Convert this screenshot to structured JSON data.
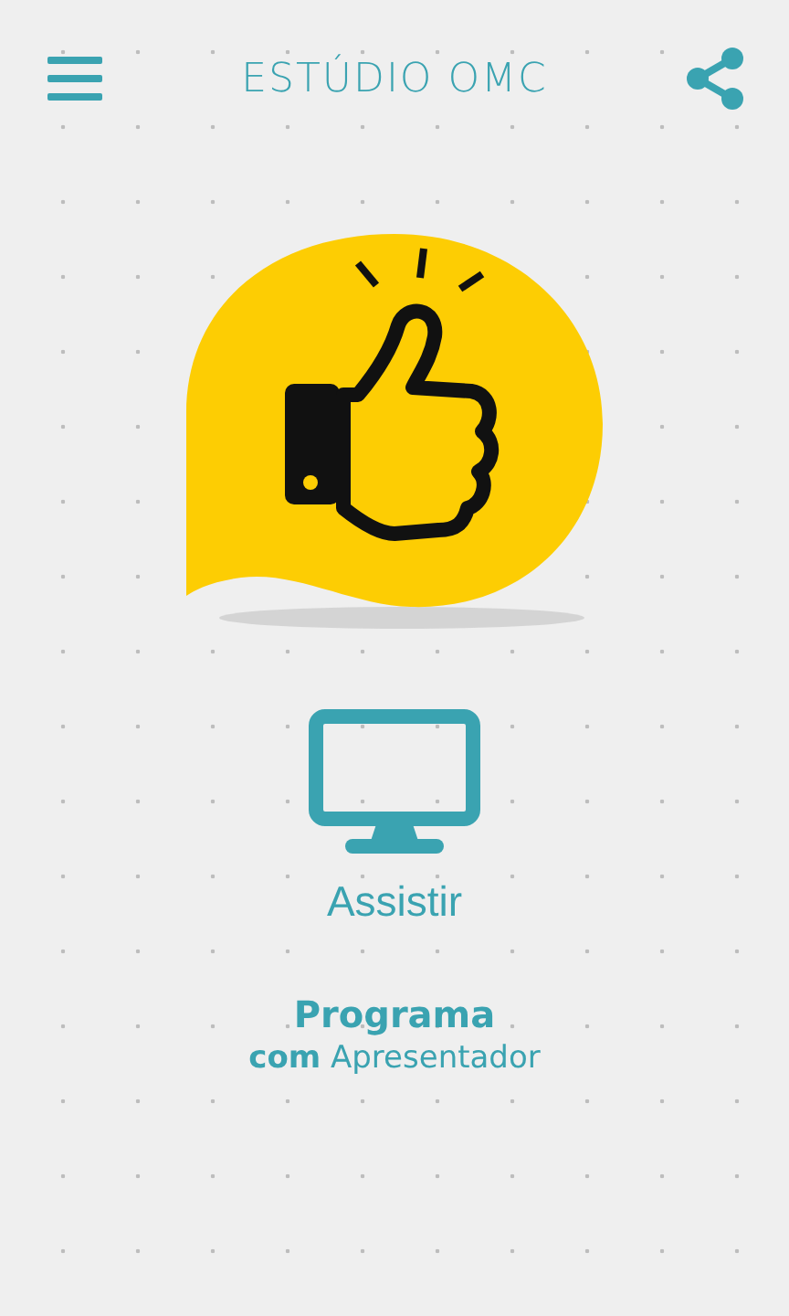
{
  "header": {
    "title": "ESTÚDIO OMC"
  },
  "action": {
    "label": "Assistir"
  },
  "program": {
    "title": "Programa",
    "subtitle": "**com** Apresentador"
  }
}
